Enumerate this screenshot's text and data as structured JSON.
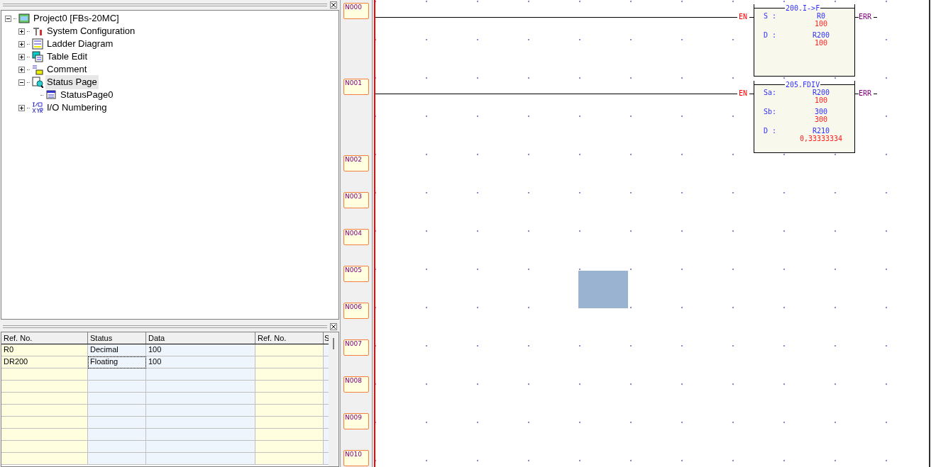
{
  "tree": {
    "label": "Project0 [FBs-20MC]",
    "kind": "project",
    "expanded": true,
    "selected": false,
    "children": [
      {
        "label": "System Configuration",
        "kind": "tools",
        "expanded": false,
        "selected": false
      },
      {
        "label": "Ladder Diagram",
        "kind": "ladder",
        "expanded": false,
        "selected": false
      },
      {
        "label": "Table Edit",
        "kind": "table",
        "expanded": false,
        "selected": false
      },
      {
        "label": "Comment",
        "kind": "comment",
        "expanded": false,
        "selected": false
      },
      {
        "label": "Status Page",
        "kind": "status",
        "expanded": true,
        "selected": true,
        "children": [
          {
            "label": "StatusPage0",
            "kind": "page",
            "selected": false
          }
        ]
      },
      {
        "label": "I/O Numbering",
        "kind": "io",
        "expanded": false,
        "selected": false
      }
    ]
  },
  "status_table": {
    "columns": [
      "Ref. No.",
      "Status",
      "Data",
      "Ref. No.",
      "S"
    ],
    "rows": [
      {
        "cells": [
          {
            "text": "R0",
            "selected": false
          },
          {
            "text": "Decimal",
            "selected": false
          },
          {
            "text": "100",
            "selected": false
          }
        ]
      },
      {
        "cells": [
          {
            "text": "DR200",
            "selected": false
          },
          {
            "text": "Floating",
            "selected": true
          },
          {
            "text": "100",
            "selected": false
          }
        ]
      }
    ]
  },
  "networks": [
    "N000",
    "N001",
    "N002",
    "N003",
    "N004",
    "N005",
    "N006",
    "N007",
    "N008",
    "N009",
    "N010"
  ],
  "blocks": [
    {
      "title": "200.I->F",
      "input": "EN",
      "output": "ERR",
      "params": [
        {
          "label": "S :",
          "ref": "R0",
          "value": "100"
        },
        {
          "label": "D :",
          "ref": "R200",
          "value": "100"
        }
      ]
    },
    {
      "title": "205.FDIV",
      "input": "EN",
      "output": "ERR",
      "params": [
        {
          "label": "Sa:",
          "ref": "R200",
          "value": "100"
        },
        {
          "label": "Sb:",
          "ref": "300",
          "value": "300"
        },
        {
          "label": "D :",
          "ref": "R210",
          "value": "0,33333334"
        }
      ]
    }
  ]
}
